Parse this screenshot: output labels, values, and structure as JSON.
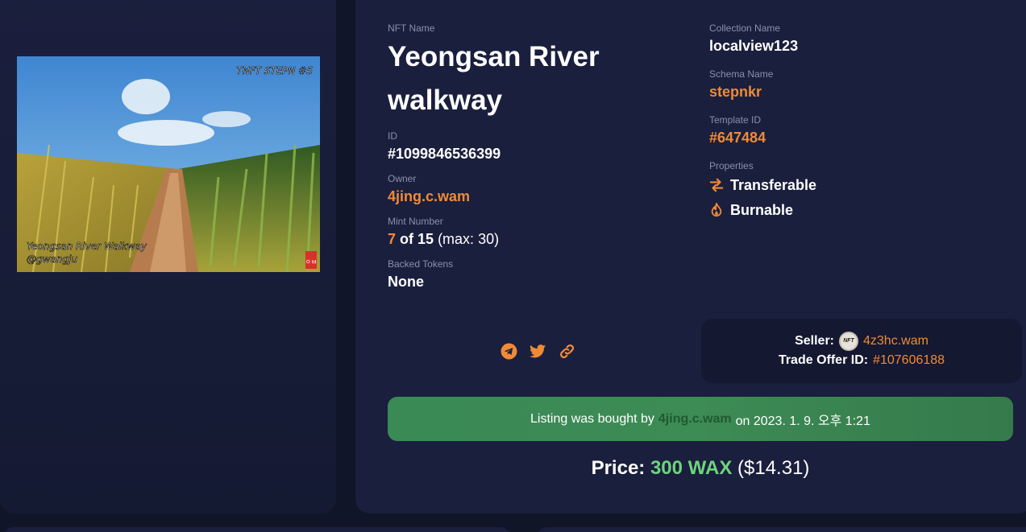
{
  "nft": {
    "name_label": "NFT Name",
    "name": "Yeongsan River walkway",
    "id_label": "ID",
    "id": "#1099846536399",
    "owner_label": "Owner",
    "owner": "4jing.c.wam",
    "mint_label": "Mint Number",
    "mint_number": "7",
    "mint_of": "of 15",
    "mint_max": "(max: 30)",
    "backed_label": "Backed Tokens",
    "backed": "None",
    "collection_label": "Collection Name",
    "collection": "localview123",
    "schema_label": "Schema Name",
    "schema": "stepnkr",
    "template_label": "Template ID",
    "template": "#647484",
    "properties_label": "Properties",
    "properties": [
      "Transferable",
      "Burnable"
    ]
  },
  "image": {
    "caption_top": "TNFT STEPN #5",
    "caption_bottom_1": "Yeongsan River Walkway",
    "caption_bottom_2": "@gwangju",
    "stamp_text": "ㅇㅂ"
  },
  "social": {
    "icons": [
      "telegram-icon",
      "twitter-icon",
      "link-icon"
    ]
  },
  "seller": {
    "seller_label": "Seller:",
    "seller": "4z3hc.wam",
    "avatar_text": "NFT",
    "offer_label": "Trade Offer ID:",
    "offer_id": "#107606188"
  },
  "sale": {
    "prefix": "Listing was bought by",
    "buyer": "4jing.c.wam",
    "suffix": "on 2023. 1. 9. 오후 1:21"
  },
  "price": {
    "label": "Price:",
    "amount": "300 WAX",
    "usd": "($14.31)"
  },
  "colors": {
    "background": "#111528",
    "card": "#1a1f3d",
    "accent_orange": "#f08a36",
    "price_green": "#6ed47c",
    "banner_green": "#3d8b55"
  }
}
